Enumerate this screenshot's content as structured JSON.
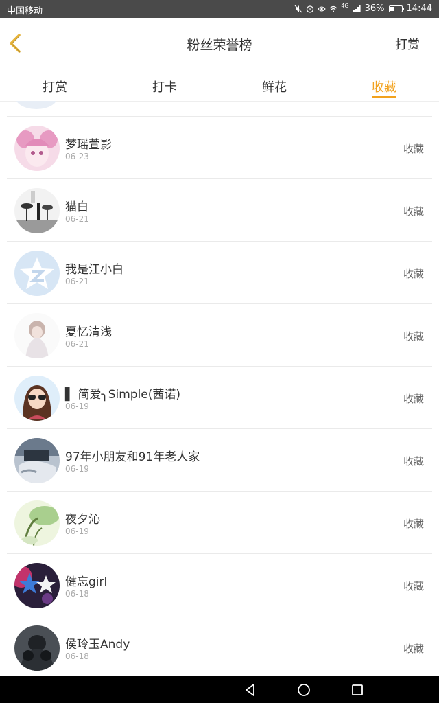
{
  "status_bar": {
    "carrier": "中国移动",
    "network": "4G",
    "battery": "36%",
    "time": "14:44"
  },
  "header": {
    "title": "粉丝荣誉榜",
    "action": "打赏"
  },
  "tabs": [
    {
      "label": "打赏",
      "active": false
    },
    {
      "label": "打卡",
      "active": false
    },
    {
      "label": "鲜花",
      "active": false
    },
    {
      "label": "收藏",
      "active": true
    }
  ],
  "accent_color": "#f2a21e",
  "fans": [
    {
      "name": "梦瑶萱影",
      "date": "06-23",
      "type": "收藏"
    },
    {
      "name": "猫白",
      "date": "06-21",
      "type": "收藏"
    },
    {
      "name": "我是江小白",
      "date": "06-21",
      "type": "收藏"
    },
    {
      "name": "夏忆清浅",
      "date": "06-21",
      "type": "收藏"
    },
    {
      "name": "▌ 简爱╮Simple(茜诺)",
      "date": "06-19",
      "type": "收藏"
    },
    {
      "name": "97年小朋友和91年老人家",
      "date": "06-19",
      "type": "收藏"
    },
    {
      "name": "夜夕沁",
      "date": "06-19",
      "type": "收藏"
    },
    {
      "name": "健忘girl",
      "date": "06-18",
      "type": "收藏"
    },
    {
      "name": "侯玲玉Andy",
      "date": "06-18",
      "type": "收藏"
    }
  ],
  "nav_icons": [
    "back-triangle-icon",
    "home-circle-icon",
    "recents-square-icon"
  ]
}
